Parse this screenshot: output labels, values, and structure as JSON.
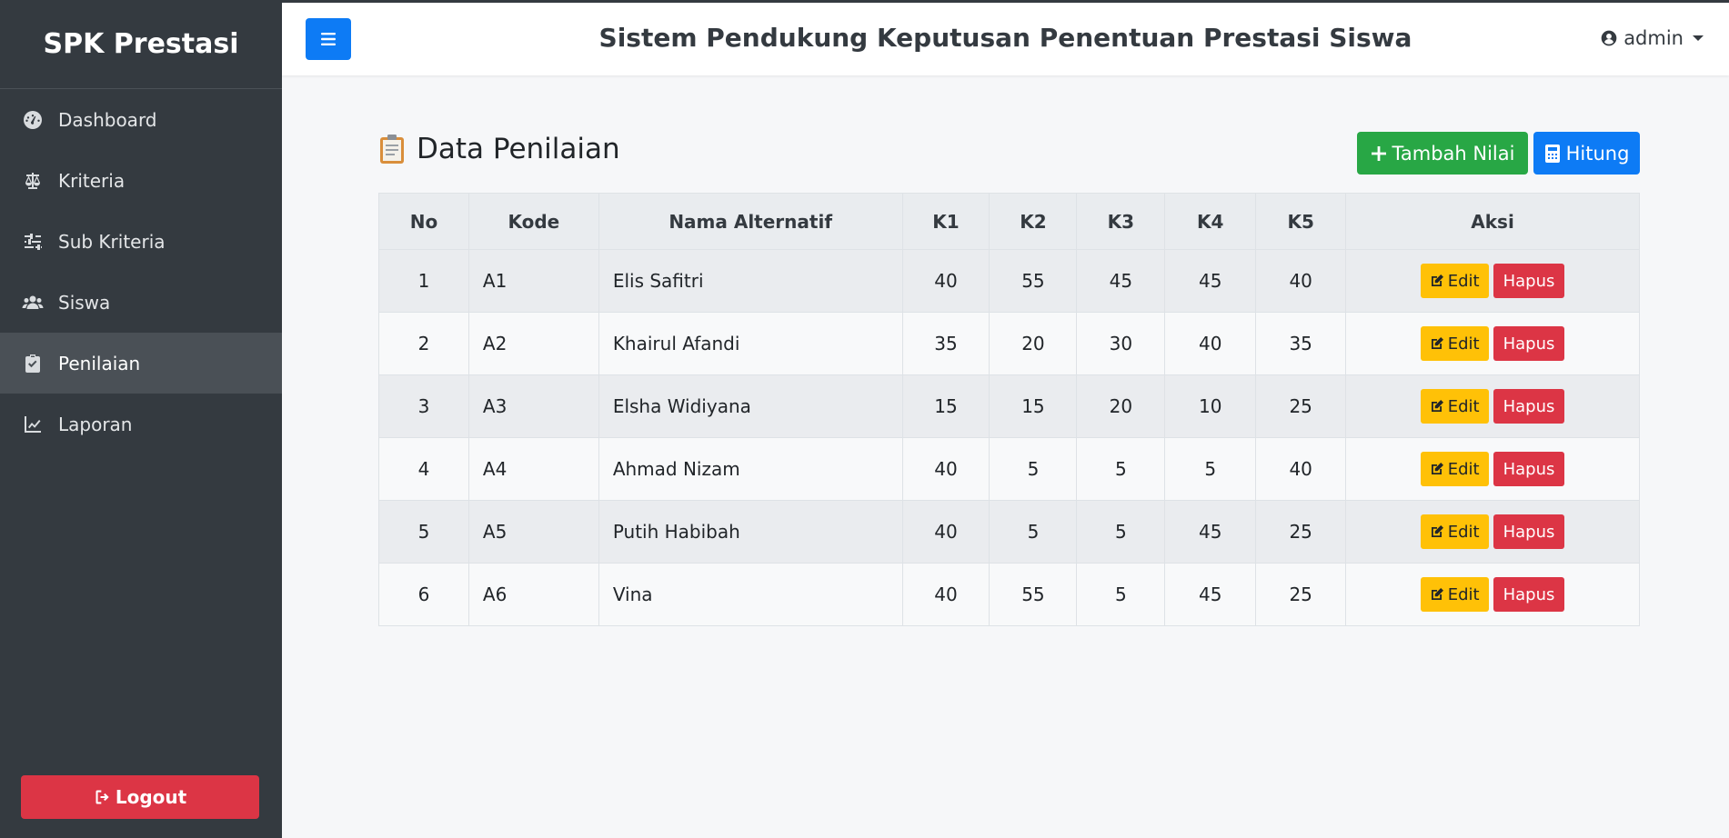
{
  "sidebar": {
    "brand": "SPK Prestasi",
    "items": [
      {
        "label": "Dashboard",
        "icon": "dashboard-icon"
      },
      {
        "label": "Kriteria",
        "icon": "balance-scale-icon"
      },
      {
        "label": "Sub Kriteria",
        "icon": "sliders-icon"
      },
      {
        "label": "Siswa",
        "icon": "users-icon"
      },
      {
        "label": "Penilaian",
        "icon": "clipboard-check-icon",
        "active": true
      },
      {
        "label": "Laporan",
        "icon": "line-chart-icon"
      }
    ],
    "logout_label": "Logout"
  },
  "header": {
    "title": "Sistem Pendukung Keputusan Penentuan Prestasi Siswa",
    "user": "admin"
  },
  "main": {
    "title": "Data Penilaian",
    "add_button": "Tambah Nilai",
    "calc_button": "Hitung",
    "columns": [
      "No",
      "Kode",
      "Nama Alternatif",
      "K1",
      "K2",
      "K3",
      "K4",
      "K5",
      "Aksi"
    ],
    "rows": [
      {
        "no": "1",
        "kode": "A1",
        "nama": "Elis Safitri",
        "k1": "40",
        "k2": "55",
        "k3": "45",
        "k4": "45",
        "k5": "40"
      },
      {
        "no": "2",
        "kode": "A2",
        "nama": "Khairul Afandi",
        "k1": "35",
        "k2": "20",
        "k3": "30",
        "k4": "40",
        "k5": "35"
      },
      {
        "no": "3",
        "kode": "A3",
        "nama": "Elsha Widiyana",
        "k1": "15",
        "k2": "15",
        "k3": "20",
        "k4": "10",
        "k5": "25"
      },
      {
        "no": "4",
        "kode": "A4",
        "nama": "Ahmad Nizam",
        "k1": "40",
        "k2": "5",
        "k3": "5",
        "k4": "5",
        "k5": "40"
      },
      {
        "no": "5",
        "kode": "A5",
        "nama": "Putih Habibah",
        "k1": "40",
        "k2": "5",
        "k3": "5",
        "k4": "45",
        "k5": "25"
      },
      {
        "no": "6",
        "kode": "A6",
        "nama": "Vina",
        "k1": "40",
        "k2": "55",
        "k3": "5",
        "k4": "45",
        "k5": "25"
      }
    ],
    "edit_label": "Edit",
    "delete_label": "Hapus"
  },
  "colors": {
    "sidebar": "#343a40",
    "primary": "#0d7bf5",
    "success": "#28a745",
    "warning": "#ffc107",
    "danger": "#dc3545"
  }
}
